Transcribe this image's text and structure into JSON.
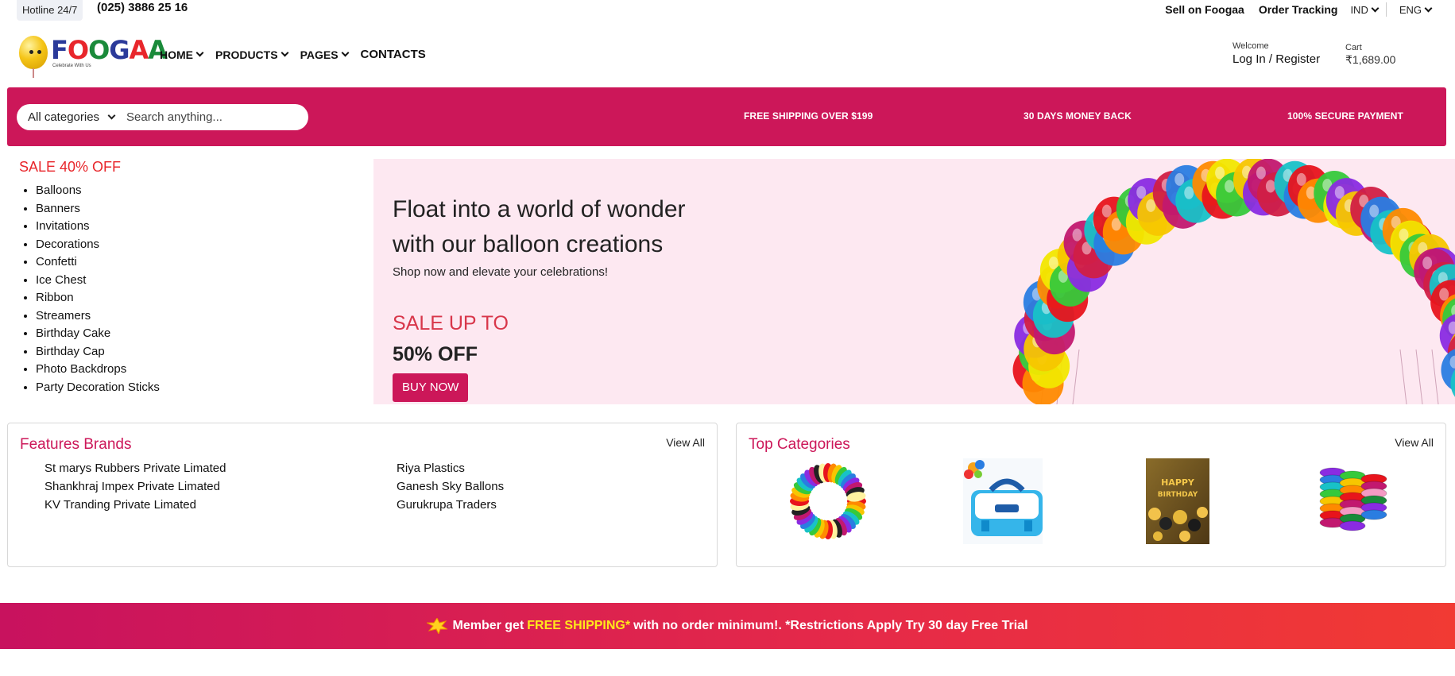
{
  "topbar": {
    "hotline": "Hotline 24/7",
    "phone": "(025) 3886 25 16",
    "links": [
      "Sell on Foogaa",
      "Order Tracking"
    ],
    "currency": "IND",
    "language": "ENG"
  },
  "header": {
    "logo_text": "FOOGAA",
    "logo_tagline": "Celebrate With Us",
    "nav": [
      {
        "label": "HOME",
        "has_dropdown": true
      },
      {
        "label": "PRODUCTS",
        "has_dropdown": true
      },
      {
        "label": "PAGES",
        "has_dropdown": true
      },
      {
        "label": "CONTACTS",
        "has_dropdown": false
      }
    ],
    "account": {
      "welcome": "Welcome",
      "action": "Log In / Register"
    },
    "cart": {
      "label": "Cart",
      "amount": "₹1,689.00"
    }
  },
  "band": {
    "category_select": "All categories",
    "search_placeholder": "Search anything...",
    "perks": [
      "FREE SHIPPING OVER $199",
      "30 DAYS MONEY BACK",
      "100% SECURE PAYMENT"
    ],
    "color": "#cc1759"
  },
  "sidebar": {
    "sale_title": "SALE 40% OFF",
    "categories": [
      "Balloons",
      "Banners",
      "Invitations",
      "Decorations",
      "Confetti",
      "Ice Chest",
      "Ribbon",
      "Streamers",
      "Birthday Cake",
      "Birthday Cap",
      "Photo Backdrops",
      "Party Decoration Sticks"
    ]
  },
  "hero": {
    "title_line1": "Float into a world of wonder",
    "title_line2": "with our balloon creations",
    "subtitle": "Shop now and elevate your celebrations!",
    "sale_label": "SALE UP TO",
    "discount": "50% OFF",
    "cta": "BUY NOW",
    "background": "#fde8f1"
  },
  "brands_panel": {
    "title": "Features Brands",
    "view_all": "View All",
    "brands": [
      "St marys Rubbers Private Limated",
      "Riya Plastics",
      "Shankhraj Impex Private Limated",
      "Ganesh Sky Ballons",
      "KV Tranding Private Limated",
      "Gurukrupa Traders"
    ]
  },
  "categories_panel": {
    "title": "Top Categories",
    "view_all": "View All",
    "images": [
      "balloon-bundle-image",
      "balloon-pump-image",
      "happy-birthday-decor-image",
      "ribbon-rolls-image"
    ]
  },
  "promo": {
    "prefix": "Member get",
    "highlight": "FREE SHIPPING*",
    "suffix": "with no order minimum!. *Restrictions Apply Try 30 day Free Trial",
    "highlight_color": "#ffe81a"
  }
}
